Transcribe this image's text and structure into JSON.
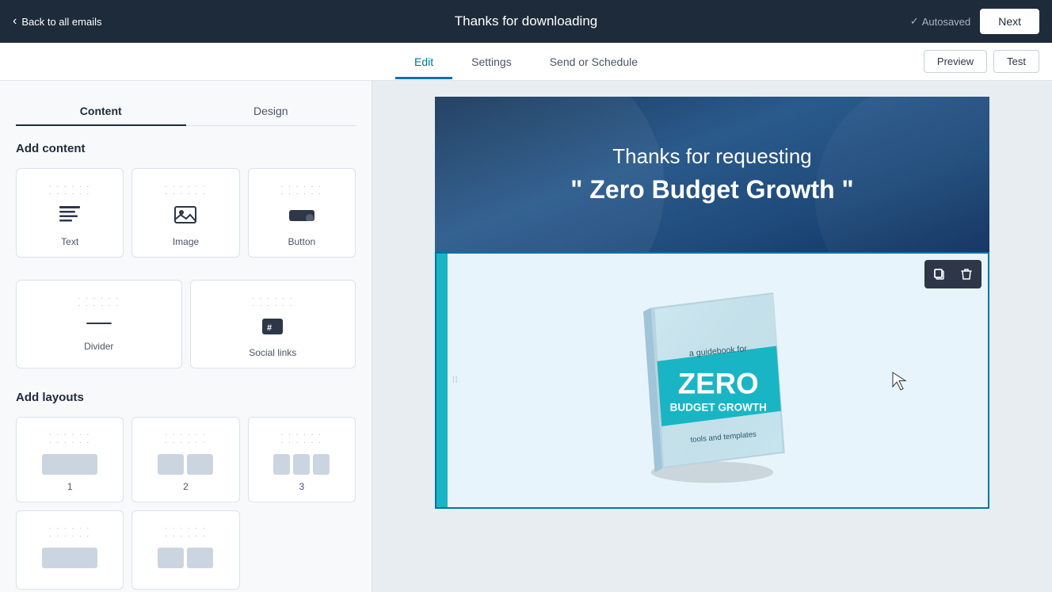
{
  "topNav": {
    "backLabel": "Back to all emails",
    "title": "Thanks for downloading",
    "autosaved": "Autosaved",
    "nextLabel": "Next"
  },
  "tabs": {
    "edit": "Edit",
    "settings": "Settings",
    "sendOrSchedule": "Send or Schedule",
    "previewLabel": "Preview",
    "testLabel": "Test",
    "activeTab": "edit"
  },
  "sidebar": {
    "contentTab": "Content",
    "designTab": "Design",
    "addContentTitle": "Add content",
    "blocks": [
      {
        "id": "text",
        "label": "Text"
      },
      {
        "id": "image",
        "label": "Image"
      },
      {
        "id": "button",
        "label": "Button"
      },
      {
        "id": "divider",
        "label": "Divider"
      },
      {
        "id": "social",
        "label": "Social links"
      }
    ],
    "addLayoutsTitle": "Add layouts",
    "layouts": [
      {
        "id": "1",
        "label": "1",
        "cols": 1
      },
      {
        "id": "2",
        "label": "2",
        "cols": 2
      },
      {
        "id": "3",
        "label": "3",
        "cols": 3
      }
    ]
  },
  "canvas": {
    "hero": {
      "line1": "Thanks for requesting",
      "line2": "\" Zero Budget Growth \""
    },
    "book": {
      "subtitle": "a guidebook for",
      "title": "ZERO",
      "title2": "BUDGET GROWTH",
      "footer": "tools and templates"
    }
  },
  "icons": {
    "chevronLeft": "‹",
    "check": "✓",
    "copy": "⧉",
    "trash": "🗑",
    "cursor": "↖"
  }
}
